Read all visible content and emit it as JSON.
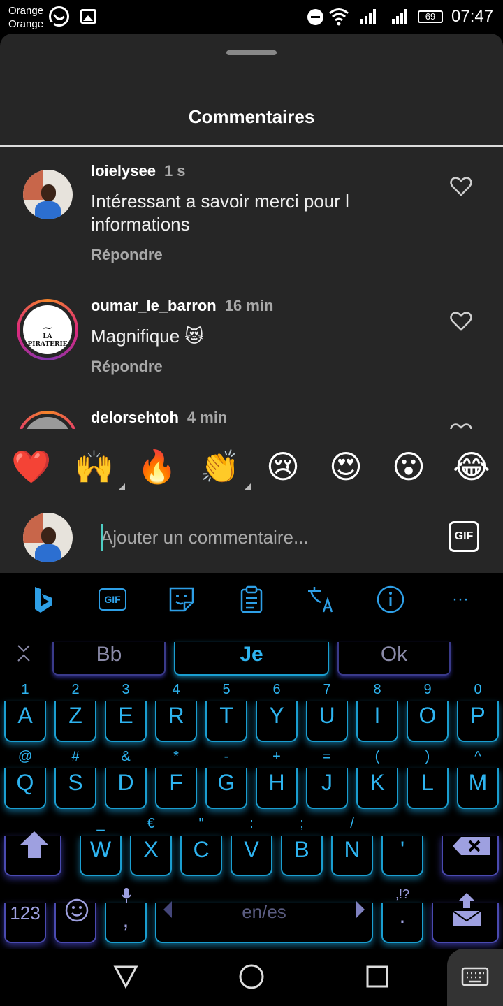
{
  "status_bar": {
    "carrier_1": "Orange",
    "carrier_2": "Orange",
    "battery": "69",
    "time": "07:47",
    "icons": [
      "whatsapp-icon",
      "image-icon",
      "dnd-icon",
      "wifi-icon",
      "signal-icon",
      "signal-icon",
      "battery-icon"
    ]
  },
  "sheet": {
    "title": "Commentaires"
  },
  "comments": [
    {
      "username": "loielysee",
      "time": "1 s",
      "text": "Intéressant a savoir merci pour l informations",
      "reply": "Répondre"
    },
    {
      "username": "oumar_le_barron",
      "time": "16 min",
      "text": "Magnifique 😻",
      "reply": "Répondre",
      "avatar_logo_text": "LA PIRATERIE"
    },
    {
      "username": "delorsehtoh",
      "time": "4 min"
    }
  ],
  "emoji_bar": [
    "❤️",
    "🙌",
    "🔥",
    "👏",
    "😢",
    "😍",
    "😮",
    "😂"
  ],
  "composer": {
    "placeholder": "Ajouter un commentaire...",
    "gif_label": "GIF"
  },
  "keyboard": {
    "toolbar": {
      "gif_label": "GIF",
      "more": "···",
      "icons": [
        "bing-icon",
        "gif-icon",
        "sticker-icon",
        "clipboard-icon",
        "translate-icon",
        "info-icon",
        "more-icon"
      ]
    },
    "suggestions": [
      "Bb",
      "Je",
      "Ok"
    ],
    "row1": [
      [
        "1",
        "A"
      ],
      [
        "2",
        "Z"
      ],
      [
        "3",
        "E"
      ],
      [
        "4",
        "R"
      ],
      [
        "5",
        "T"
      ],
      [
        "6",
        "Y"
      ],
      [
        "7",
        "U"
      ],
      [
        "8",
        "I"
      ],
      [
        "9",
        "O"
      ],
      [
        "0",
        "P"
      ]
    ],
    "row2": [
      [
        "@",
        "Q"
      ],
      [
        "#",
        "S"
      ],
      [
        "&",
        "D"
      ],
      [
        "*",
        "F"
      ],
      [
        "-",
        "G"
      ],
      [
        "+",
        "H"
      ],
      [
        "=",
        "J"
      ],
      [
        "(",
        "K"
      ],
      [
        ")",
        "L"
      ],
      [
        "^",
        "M"
      ]
    ],
    "row3": [
      [
        "_",
        "W"
      ],
      [
        "€",
        "X"
      ],
      [
        "\"",
        "C"
      ],
      [
        ":",
        "V"
      ],
      [
        ";",
        "B"
      ],
      [
        "/",
        "N"
      ],
      [
        "",
        "'"
      ]
    ],
    "num_key": "123",
    "comma": ",",
    "space_label": "en/es",
    "period_hint": ",!?",
    "period": "."
  },
  "colors": {
    "sheet_bg": "#262626",
    "key_glow": "#1a9ed0",
    "key_text": "#2eb4f0",
    "muted": "#a8a8a8"
  }
}
